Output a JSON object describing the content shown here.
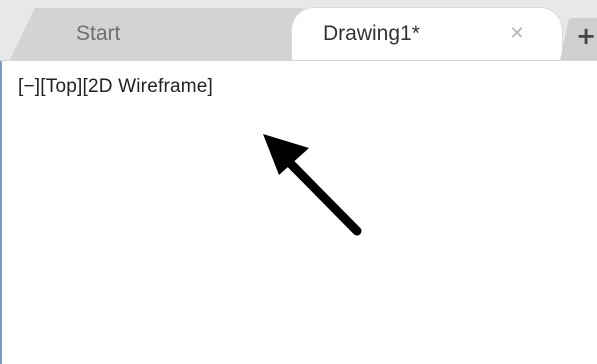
{
  "tabs": [
    {
      "label": "Start"
    },
    {
      "label": "Drawing1*"
    }
  ],
  "icons": {
    "close": "close-icon",
    "new_tab": "plus-icon",
    "annotation": "arrow-icon"
  },
  "viewport": {
    "minus_control": "[−]",
    "view_control": "[Top]",
    "visual_style_control": "[2D Wireframe]"
  },
  "colors": {
    "active_tab": "#ffffff",
    "inactive_tab": "#d3d3d3",
    "arrow": "#000000"
  }
}
